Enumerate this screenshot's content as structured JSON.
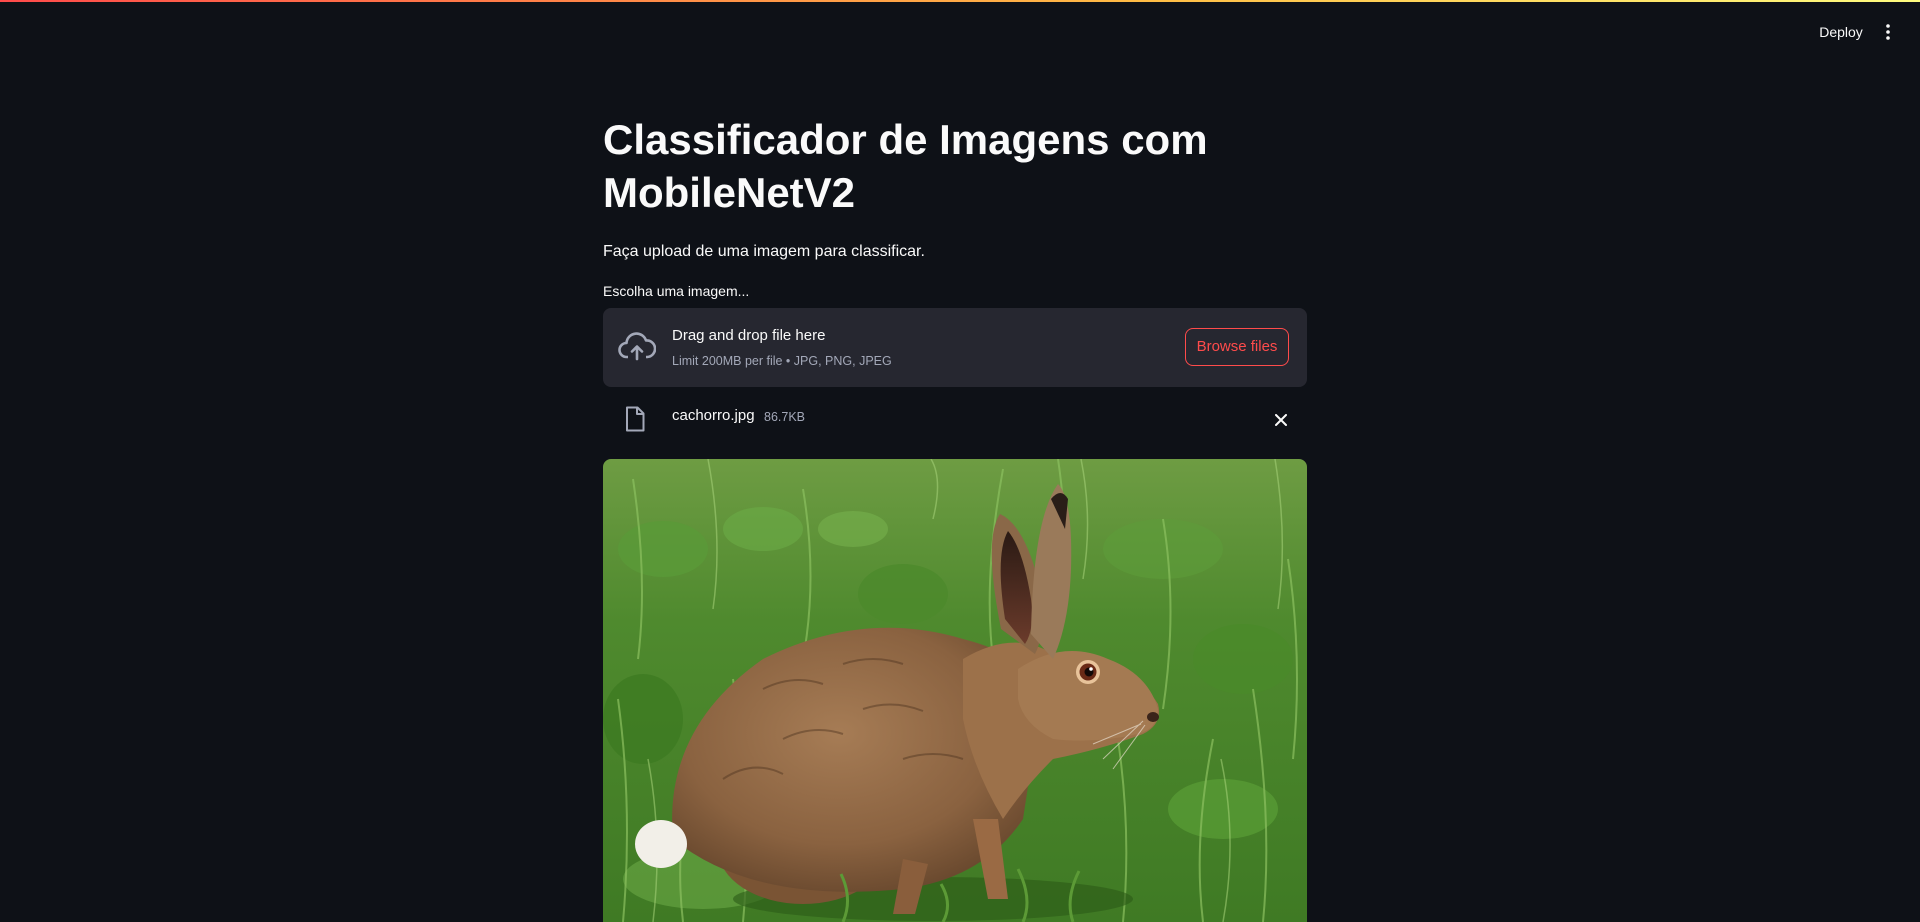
{
  "header": {
    "deploy_label": "Deploy",
    "menu_icon": "vertical-dots-icon"
  },
  "main": {
    "title": "Classificador de Imagens com MobileNetV2",
    "subtitle": "Faça upload de uma imagem para classificar.",
    "uploader": {
      "label": "Escolha uma imagem...",
      "drop_title": "Drag and drop file here",
      "drop_limit": "Limit 200MB per file • JPG, PNG, JPEG",
      "browse_label": "Browse files",
      "upload_icon": "cloud-upload-icon"
    },
    "uploaded_file": {
      "name": "cachorro.jpg",
      "size": "86.7KB",
      "file_icon": "file-icon",
      "remove_icon": "close-icon"
    },
    "image": {
      "subject": "brown hare sitting in green grass"
    }
  },
  "colors": {
    "background": "#0e1117",
    "dropzone": "#262730",
    "accent": "#ff4b4b",
    "muted_text": "#a3a8b8"
  }
}
